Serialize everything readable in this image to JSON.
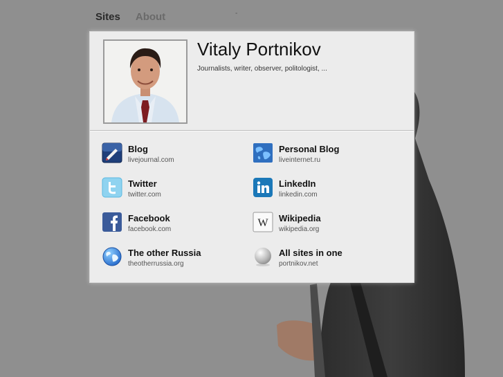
{
  "nav": {
    "items": [
      {
        "label": "Sites"
      },
      {
        "label": "About"
      }
    ],
    "dash": "-"
  },
  "profile": {
    "name": "Vitaly Portnikov",
    "description": "Journalists, writer, observer, politologist, ..."
  },
  "links": [
    {
      "title": "Blog",
      "url": "livejournal.com",
      "icon": "livejournal-icon"
    },
    {
      "title": "Personal Blog",
      "url": "liveinternet.ru",
      "icon": "liveinternet-globe-icon"
    },
    {
      "title": "Twitter",
      "url": "twitter.com",
      "icon": "twitter-icon"
    },
    {
      "title": "LinkedIn",
      "url": "linkedin.com",
      "icon": "linkedin-icon"
    },
    {
      "title": "Facebook",
      "url": "facebook.com",
      "icon": "facebook-icon"
    },
    {
      "title": "Wikipedia",
      "url": "wikipedia.org",
      "icon": "wikipedia-icon"
    },
    {
      "title": "The other Russia",
      "url": "theotherrussia.org",
      "icon": "globe-icon"
    },
    {
      "title": "All sites in one",
      "url": "portnikov.net",
      "icon": "sphere-icon"
    }
  ],
  "colors": {
    "background": "#8f8f8f",
    "card": "#ececec",
    "text": "#111111",
    "subtext": "#555555"
  }
}
